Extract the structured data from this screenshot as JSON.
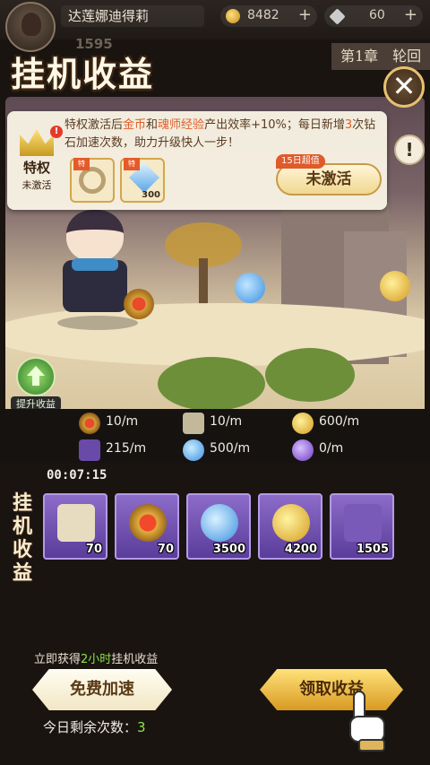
{
  "topbar": {
    "player_name": "达莲娜迪得莉",
    "power": "1595",
    "gold": "8482",
    "gems": "60",
    "plus": "+"
  },
  "chapter": "第1章　轮回",
  "title": "挂机收益",
  "close": "✕",
  "privilege": {
    "text_1": "特权激活后",
    "hl_1": "金币",
    "text_2": "和",
    "hl_2": "魂师经验",
    "text_3": "产出效率+10%；每日新增",
    "hl_3": "3",
    "text_4": "次钻石加速次数，助力升级快人一步！",
    "badge_label": "特权",
    "badge_status": "未激活",
    "red_dot": "!",
    "reward_flag": "特",
    "diamond_qty": "300",
    "activate_tag": "15日超值",
    "activate_label": "未激活"
  },
  "info_button": "!",
  "boost_label": "提升收益",
  "rates": [
    {
      "icon": "crest-icon",
      "value": "10/m"
    },
    {
      "icon": "scroll-icon",
      "value": "10/m"
    },
    {
      "icon": "coin-icon",
      "value": "600/m"
    },
    {
      "icon": "exp-book-icon",
      "value": "215/m"
    },
    {
      "icon": "potion-icon",
      "value": "500/m"
    },
    {
      "icon": "bottle-icon",
      "value": "0/m"
    }
  ],
  "timer": "00:07:15",
  "idle_label": [
    "挂",
    "机",
    "收",
    "益"
  ],
  "idle_items": [
    {
      "icon": "scroll-icon",
      "qty": "70"
    },
    {
      "icon": "crest-icon",
      "qty": "70"
    },
    {
      "icon": "potion-icon",
      "qty": "3500"
    },
    {
      "icon": "coin-icon",
      "qty": "4200"
    },
    {
      "icon": "exp-book-icon",
      "qty": "1505"
    }
  ],
  "bottom": {
    "gain_prefix": "立即获得",
    "gain_hl": "2小时",
    "gain_suffix": "挂机收益",
    "free_button": "免费加速",
    "remain_prefix": "今日剩余次数：",
    "remain_count": "3",
    "claim_button": "领取收益"
  },
  "colors": {
    "accent_gold": "#d89a22",
    "highlight_orange": "#e0602a",
    "highlight_green": "#8fe04a"
  }
}
